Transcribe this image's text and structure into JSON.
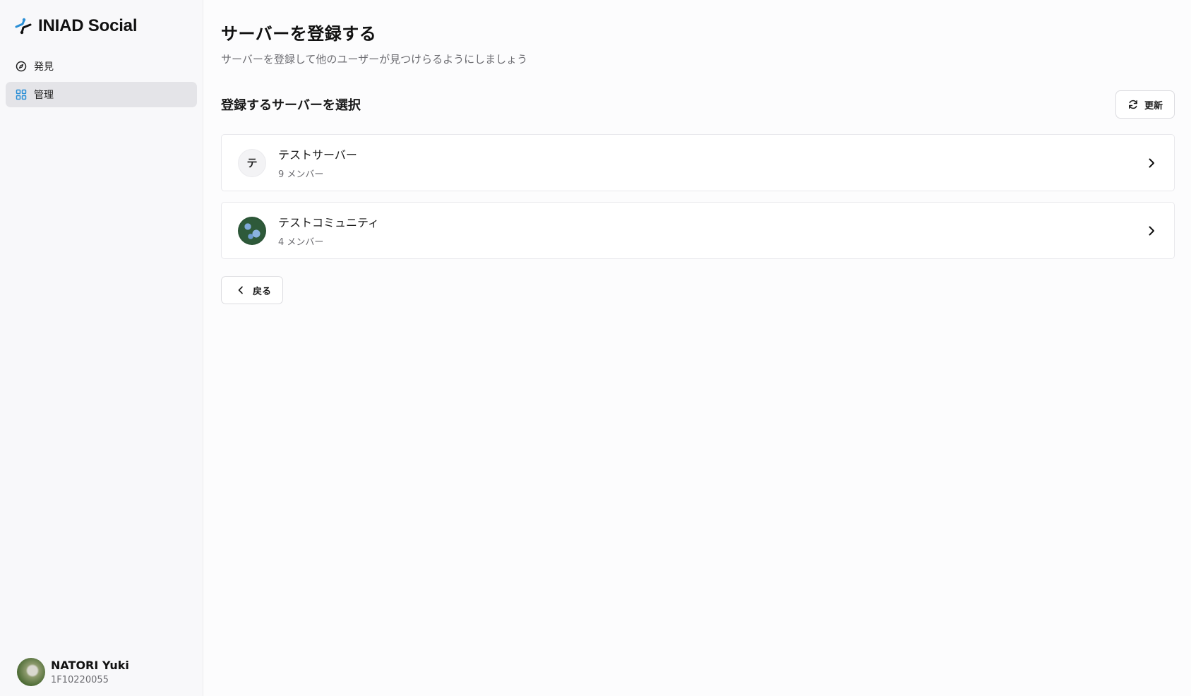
{
  "app": {
    "brand": "INIAD Social",
    "accent": "#2a8fd6"
  },
  "sidebar": {
    "items": [
      {
        "label": "発見",
        "icon": "compass-icon",
        "active": false
      },
      {
        "label": "管理",
        "icon": "grid-icon",
        "active": true
      }
    ]
  },
  "user": {
    "name": "NATORI Yuki",
    "id": "1F10220055"
  },
  "page": {
    "title": "サーバーを登録する",
    "subtitle": "サーバーを登録して他のユーザーが見つけらるようにしましょう",
    "section_title": "登録するサーバーを選択",
    "refresh_label": "更新",
    "back_label": "戻る"
  },
  "servers": [
    {
      "name": "テストサーバー",
      "members": "9 メンバー",
      "initial": "テ",
      "icon_type": "letter"
    },
    {
      "name": "テストコミュニティ",
      "members": "4 メンバー",
      "initial": "",
      "icon_type": "image"
    }
  ]
}
